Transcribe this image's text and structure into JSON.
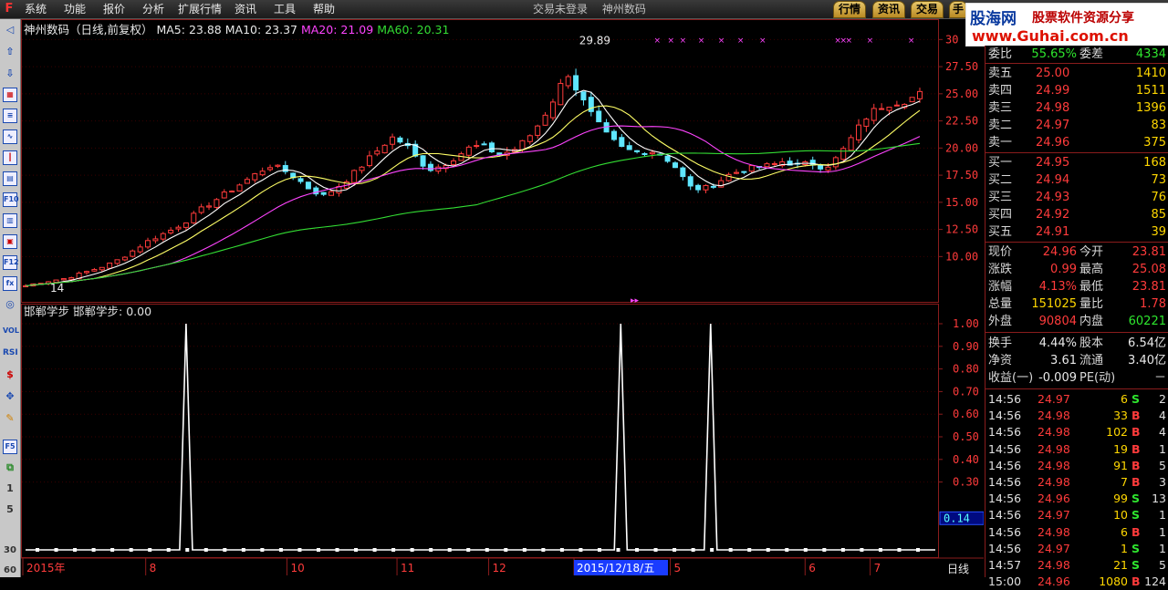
{
  "menu": {
    "items": [
      "系统",
      "功能",
      "报价",
      "分析",
      "扩展行情",
      "资讯",
      "工具",
      "帮助"
    ],
    "status": "交易未登录",
    "stock_title": "神州数码",
    "tabs": [
      "行情",
      "资讯",
      "交易",
      "手"
    ]
  },
  "banner": {
    "brand": "股海网",
    "slogan": "股票软件资源分享",
    "url": "www.Guhai.com.cn"
  },
  "toolbar": {
    "icons": [
      "app-icon",
      "up-arrow-icon",
      "down-arrow-icon",
      "refresh-icon",
      "list-icon",
      "line-chart-icon",
      "candle-icon",
      "table-icon",
      "grid-icon",
      "f10-icon",
      "doc-icon",
      "calendar-icon",
      "f12-icon",
      "formula-icon",
      "circle-icon",
      "vol-icon",
      "rsi-icon",
      "dollar-icon",
      "move-icon",
      "pen-icon",
      "f5-icon",
      "switch-icon"
    ],
    "labels": {
      "vol": "VOL",
      "rsi": "RSI",
      "f10": "F10",
      "f12": "F12",
      "f5": "F5",
      "fa": "Fa",
      "fx": "fx"
    },
    "side_numbers": [
      "1",
      "5",
      "30",
      "60"
    ]
  },
  "price_panel": {
    "title": "神州数码（日线,前复权）",
    "ma5_label": "MA5:",
    "ma5": "23.88",
    "ma10_label": "MA10:",
    "ma10": "23.37",
    "ma20_label": "MA20:",
    "ma20": "21.09",
    "ma60_label": "MA60:",
    "ma60": "20.31",
    "high_mark": "29.89",
    "low_mark": "14"
  },
  "indicator_panel": {
    "title": "邯郸学步",
    "label": "邯郸学步:",
    "value": "0.00",
    "current_tag": "0.14"
  },
  "chart_data": [
    {
      "type": "candlestick",
      "title": "神州数码（日线,前复权）",
      "ylim": [
        6.5,
        30.7
      ],
      "y_ticks": [
        "30",
        "27.50",
        "25.00",
        "22.50",
        "20.00",
        "17.50",
        "15.00",
        "12.50",
        "10.00"
      ],
      "series": [
        {
          "name": "MA5",
          "last": 23.88,
          "color": "#ffffff"
        },
        {
          "name": "MA10",
          "last": 23.37,
          "color": "#ffff66"
        },
        {
          "name": "MA20",
          "last": 21.09,
          "color": "#ff44ff"
        },
        {
          "name": "MA60",
          "last": 20.31,
          "color": "#33dd33"
        }
      ],
      "annotations": [
        "29.89",
        "14"
      ],
      "x_ticks": [
        "2015年",
        "8",
        "10",
        "11",
        "12",
        "2015/12/18/五",
        "5",
        "6",
        "7"
      ],
      "close_path": [
        7.3,
        7.6,
        7.8,
        8.0,
        8.4,
        8.8,
        9.2,
        9.8,
        10.6,
        11.4,
        12.0,
        12.6,
        13.4,
        14.4,
        15.2,
        16.0,
        16.8,
        17.6,
        18.4,
        18.0,
        17.2,
        16.2,
        15.6,
        16.4,
        17.4,
        18.6,
        19.8,
        21.0,
        20.4,
        18.8,
        18.0,
        18.6,
        19.4,
        20.2,
        20.0,
        19.4,
        19.8,
        20.8,
        22.4,
        24.6,
        27.0,
        24.6,
        22.6,
        21.0,
        20.0,
        19.6,
        19.8,
        19.4,
        18.2,
        16.4,
        16.2,
        16.8,
        17.6,
        18.0,
        18.2,
        18.4,
        18.8,
        18.4,
        18.6,
        18.2,
        19.2,
        21.0,
        22.8,
        23.8,
        24.2,
        24.4,
        24.96
      ]
    },
    {
      "type": "line",
      "title": "邯郸学步",
      "ylim": [
        0,
        1.0
      ],
      "y_ticks": [
        "1.00",
        "0.90",
        "0.80",
        "0.70",
        "0.60",
        "0.50",
        "0.40",
        "0.30"
      ],
      "values": [
        0,
        0,
        0,
        0,
        0,
        0,
        0,
        0,
        0,
        1,
        0,
        0,
        0,
        0,
        0,
        0,
        0,
        0,
        0,
        0,
        0,
        0,
        0,
        0,
        0,
        0,
        0,
        0,
        0,
        0,
        0,
        0,
        1,
        0,
        0,
        0,
        0,
        1,
        0,
        0,
        0,
        0,
        0,
        0,
        0,
        0,
        0,
        0
      ],
      "spike_positions": [
        0.18,
        0.654,
        0.752
      ],
      "period_label": "日线"
    }
  ],
  "quote": {
    "weibi_label": "委比",
    "weibi_value": "55.65%",
    "weicha_label": "委差",
    "weicha_value": "4334",
    "asks": [
      {
        "label": "卖五",
        "price": "25.00",
        "vol": "1410"
      },
      {
        "label": "卖四",
        "price": "24.99",
        "vol": "1511"
      },
      {
        "label": "卖三",
        "price": "24.98",
        "vol": "1396"
      },
      {
        "label": "卖二",
        "price": "24.97",
        "vol": "83"
      },
      {
        "label": "卖一",
        "price": "24.96",
        "vol": "375"
      }
    ],
    "bids": [
      {
        "label": "买一",
        "price": "24.95",
        "vol": "168"
      },
      {
        "label": "买二",
        "price": "24.94",
        "vol": "73"
      },
      {
        "label": "买三",
        "price": "24.93",
        "vol": "76"
      },
      {
        "label": "买四",
        "price": "24.92",
        "vol": "85"
      },
      {
        "label": "买五",
        "price": "24.91",
        "vol": "39"
      }
    ],
    "stats": [
      {
        "l1": "现价",
        "v1": "24.96",
        "c1": "red",
        "l2": "今开",
        "v2": "23.81",
        "c2": "red"
      },
      {
        "l1": "涨跌",
        "v1": "0.99",
        "c1": "red",
        "l2": "最高",
        "v2": "25.08",
        "c2": "red"
      },
      {
        "l1": "涨幅",
        "v1": "4.13%",
        "c1": "red",
        "l2": "最低",
        "v2": "23.81",
        "c2": "red"
      },
      {
        "l1": "总量",
        "v1": "151025",
        "c1": "yellow",
        "l2": "量比",
        "v2": "1.78",
        "c2": "red"
      },
      {
        "l1": "外盘",
        "v1": "90804",
        "c1": "red",
        "l2": "内盘",
        "v2": "60221",
        "c2": "green"
      }
    ],
    "fundamentals": [
      {
        "l1": "换手",
        "v1": "4.44%",
        "l2": "股本",
        "v2": "6.54亿"
      },
      {
        "l1": "净资",
        "v1": "3.61",
        "l2": "流通",
        "v2": "3.40亿"
      },
      {
        "l1": "收益(一)",
        "v1": "-0.009",
        "l2": "PE(动)",
        "v2": "－"
      }
    ],
    "ticks": [
      {
        "time": "14:56",
        "price": "24.97",
        "vol": "6",
        "dir": "S",
        "cnt": "2"
      },
      {
        "time": "14:56",
        "price": "24.98",
        "vol": "33",
        "dir": "B",
        "cnt": "4"
      },
      {
        "time": "14:56",
        "price": "24.98",
        "vol": "102",
        "dir": "B",
        "cnt": "4"
      },
      {
        "time": "14:56",
        "price": "24.98",
        "vol": "19",
        "dir": "B",
        "cnt": "1"
      },
      {
        "time": "14:56",
        "price": "24.98",
        "vol": "91",
        "dir": "B",
        "cnt": "5"
      },
      {
        "time": "14:56",
        "price": "24.98",
        "vol": "7",
        "dir": "B",
        "cnt": "3"
      },
      {
        "time": "14:56",
        "price": "24.96",
        "vol": "99",
        "dir": "S",
        "cnt": "13"
      },
      {
        "time": "14:56",
        "price": "24.97",
        "vol": "10",
        "dir": "S",
        "cnt": "1"
      },
      {
        "time": "14:56",
        "price": "24.98",
        "vol": "6",
        "dir": "B",
        "cnt": "1"
      },
      {
        "time": "14:56",
        "price": "24.97",
        "vol": "1",
        "dir": "S",
        "cnt": "1"
      },
      {
        "time": "14:57",
        "price": "24.98",
        "vol": "21",
        "dir": "S",
        "cnt": "5"
      },
      {
        "time": "15:00",
        "price": "24.96",
        "vol": "1080",
        "dir": "B",
        "cnt": "124"
      }
    ]
  },
  "colors": {
    "up": "#ff3b3b",
    "down": "#5fe6ff",
    "frame": "#8a1c1c",
    "grid": "#3a0000"
  }
}
